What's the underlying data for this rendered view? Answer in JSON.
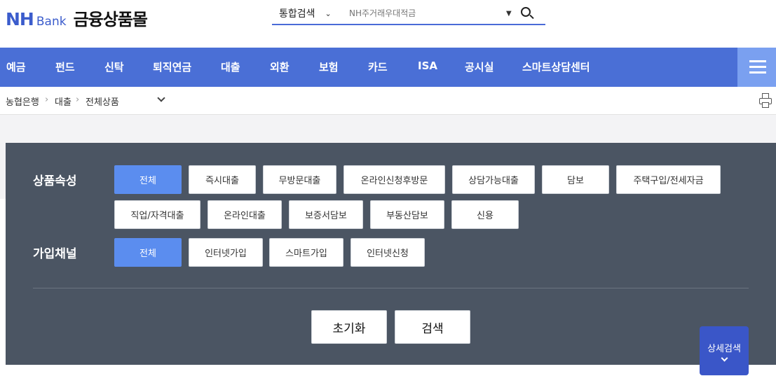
{
  "brand": {
    "logo_nh": "NH",
    "logo_bank": "Bank",
    "title": "금융상품몰",
    "accent_color": "#4a6fd6",
    "logo_color": "#3b5ccc"
  },
  "search": {
    "scope_label": "통합검색",
    "placeholder": "NH주거래우대적금",
    "button_icon": "search-icon"
  },
  "nav": {
    "items": [
      "예금",
      "펀드",
      "신탁",
      "퇴직연금",
      "대출",
      "외환",
      "보험",
      "카드",
      "ISA",
      "공시실",
      "스마트상담센터"
    ],
    "menu_icon": "hamburger-icon"
  },
  "breadcrumb": {
    "items": [
      "농협은행",
      "대출",
      "전체상품"
    ],
    "print_icon": "print-icon"
  },
  "filters": {
    "attribute": {
      "label": "상품속성",
      "options": [
        "전체",
        "즉시대출",
        "무방문대출",
        "온라인신청후방문",
        "상담가능대출",
        "담보",
        "주택구입/전세자금",
        "직업/자격대출",
        "온라인대출",
        "보증서담보",
        "부동산담보",
        "신용"
      ],
      "selected": "전체"
    },
    "channel": {
      "label": "가입채널",
      "options": [
        "전체",
        "인터넷가입",
        "스마트가입",
        "인터넷신청"
      ],
      "selected": "전체"
    },
    "reset_label": "초기화",
    "search_label": "검색",
    "detail_search_label": "상세검색"
  }
}
